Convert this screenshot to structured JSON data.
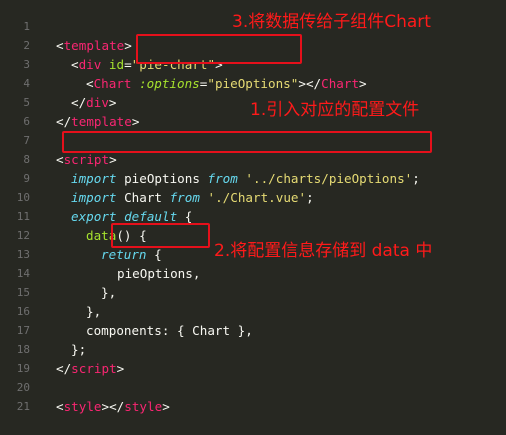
{
  "editor": {
    "lines": [
      {
        "n": "1"
      },
      {
        "n": "2"
      },
      {
        "n": "3"
      },
      {
        "n": "4"
      },
      {
        "n": "5"
      },
      {
        "n": "6"
      },
      {
        "n": "7"
      },
      {
        "n": "8"
      },
      {
        "n": "9"
      },
      {
        "n": "10"
      },
      {
        "n": "11"
      },
      {
        "n": "12"
      },
      {
        "n": "13"
      },
      {
        "n": "14"
      },
      {
        "n": "15"
      },
      {
        "n": "16"
      },
      {
        "n": "17"
      },
      {
        "n": "18"
      },
      {
        "n": "19"
      },
      {
        "n": "20"
      },
      {
        "n": "21"
      }
    ],
    "code": {
      "l1": {
        "open": "<",
        "tag": "template",
        "close": ">"
      },
      "l2": {
        "open": "<",
        "tag": "div",
        "attr": " id",
        "eq": "=",
        "val": "\"pie-chart\"",
        "close": ">"
      },
      "l3": {
        "open": "<",
        "tag": "Chart",
        "attr": " :options",
        "eq": "=",
        "val": "\"pieOptions\"",
        "mid": "></",
        "tag2": "Chart",
        "close": ">"
      },
      "l4": {
        "open": "</",
        "tag": "div",
        "close": ">"
      },
      "l5": {
        "open": "</",
        "tag": "template",
        "close": ">"
      },
      "l7": {
        "open": "<",
        "tag": "script",
        "close": ">"
      },
      "l8": {
        "kw": "import",
        "name": " pieOptions ",
        "from": "from",
        "str": " '../charts/pieOptions'",
        "end": ";"
      },
      "l9": {
        "kw": "import",
        "name": " Chart ",
        "from": "from",
        "str": " './Chart.vue'",
        "end": ";"
      },
      "l10": {
        "kw": "export",
        "kw2": " default",
        "rest": " {"
      },
      "l11": {
        "fn": "data",
        "rest": "() {"
      },
      "l12": {
        "kw": "return",
        "rest": " {"
      },
      "l13": {
        "text": "pieOptions,"
      },
      "l14": {
        "text": "},"
      },
      "l15": {
        "text": "},"
      },
      "l16": {
        "key": "components",
        "rest": ": { Chart },"
      },
      "l17": {
        "text": "};"
      },
      "l18": {
        "open": "</",
        "tag": "script",
        "close": ">"
      },
      "l20": {
        "open": "<",
        "tag": "style",
        "mid": "></",
        "tag2": "style",
        "close": ">"
      }
    }
  },
  "annotations": {
    "note1": "1.引入对应的配置文件",
    "note2": "2.将配置信息存储到 data 中",
    "note3": "3.将数据传给子组件Chart"
  },
  "colors": {
    "background": "#272822",
    "annotation": "#ff1a1a",
    "highlight_box": "#e5101b"
  }
}
